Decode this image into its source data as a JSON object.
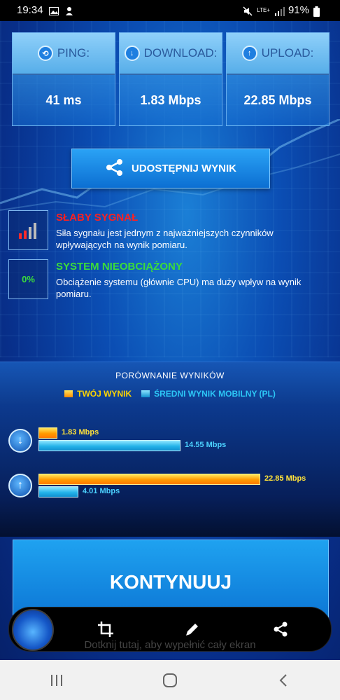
{
  "status_bar": {
    "time": "19:34",
    "network": "LTE+",
    "battery": "91%"
  },
  "metrics": [
    {
      "label": "PING:",
      "value": "41 ms",
      "icon": "ping-icon"
    },
    {
      "label": "DOWNLOAD:",
      "value": "1.83 Mbps",
      "icon": "download-icon"
    },
    {
      "label": "UPLOAD:",
      "value": "22.85 Mbps",
      "icon": "upload-icon"
    }
  ],
  "share_button": {
    "label": "UDOSTĘPNIJ WYNIK",
    "icon": "share-icon"
  },
  "signal": {
    "title": "SŁABY SYGNAŁ",
    "description": "Siła sygnału jest jednym z najważniejszych czynników wpływających na wynik pomiaru.",
    "color": "#ff2020"
  },
  "system": {
    "badge": "0%",
    "title": "SYSTEM NIEOBCIĄŻONY",
    "description": "Obciążenie systemu (głównie CPU) ma duży wpływ na wynik pomiaru.",
    "color": "#3bdc3b"
  },
  "comparison": {
    "title": "PORÓWNANIE WYNIKÓW",
    "legend_yours": "TWÓJ WYNIK",
    "legend_avg": "ŚREDNI WYNIK MOBILNY (PL)",
    "yours_color": "#ffd500",
    "avg_color": "#2cc6f5",
    "download": {
      "yours": 1.83,
      "yours_label": "1.83 Mbps",
      "avg": 14.55,
      "avg_label": "14.55 Mbps"
    },
    "upload": {
      "yours": 22.85,
      "yours_label": "22.85 Mbps",
      "avg": 4.01,
      "avg_label": "4.01 Mbps"
    },
    "scale_max": 22.85
  },
  "continue_button": {
    "label": "KONTYNUUJ"
  },
  "hint": "Dotknij tutaj, aby wypełnić cały ekran"
}
